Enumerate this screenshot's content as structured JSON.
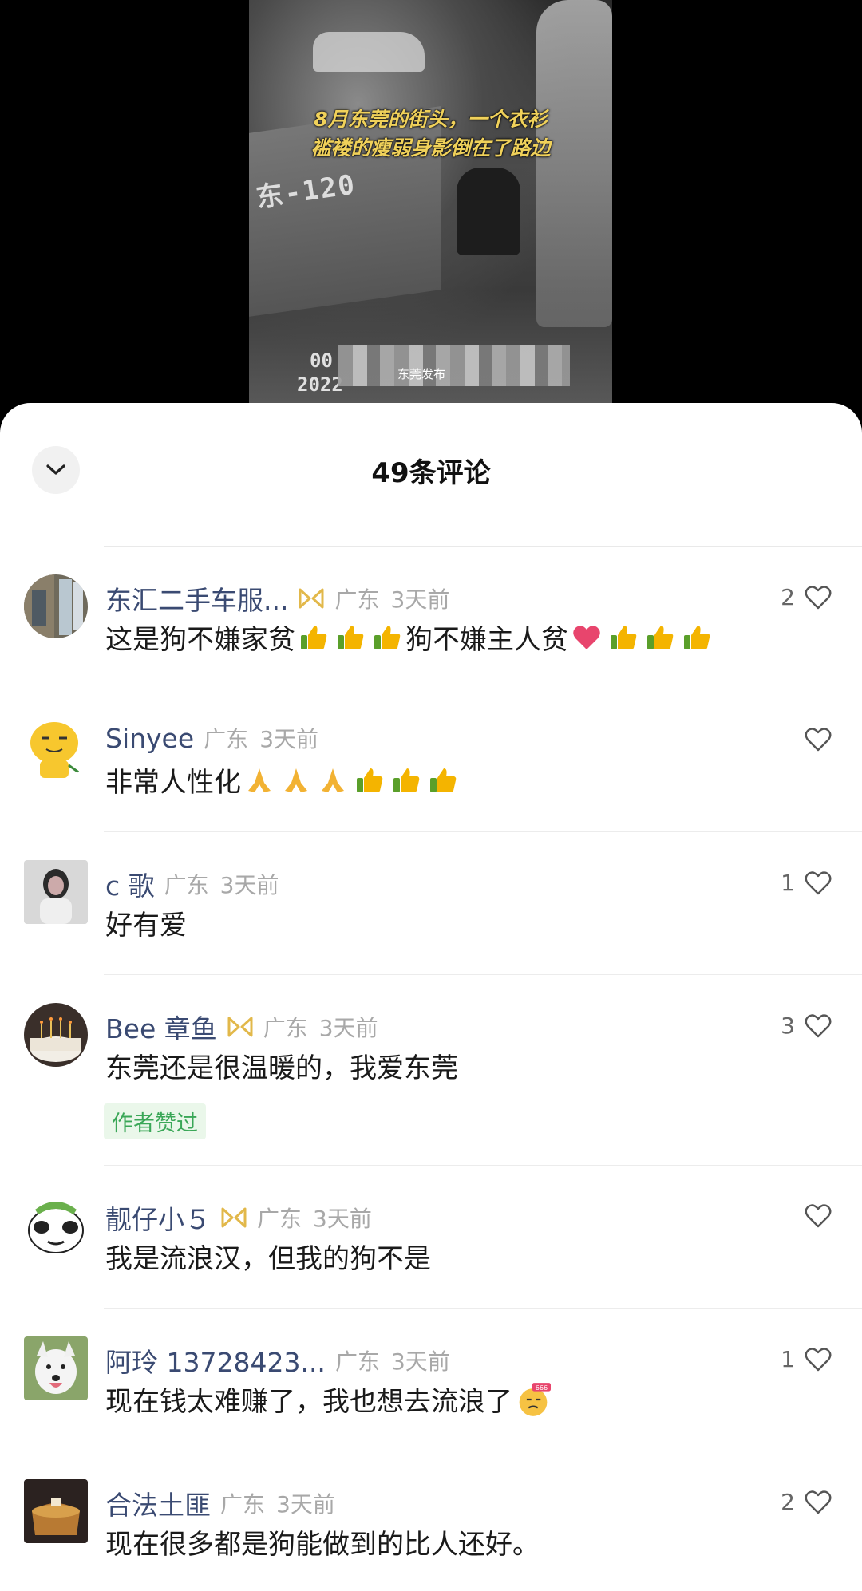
{
  "video": {
    "caption_line1": "8月东莞的街头，一个衣衫",
    "caption_line2": "褴褛的瘦弱身影倒在了路边",
    "bus_text": "东-120",
    "stamp_1": "00",
    "stamp_2": "2022",
    "watermark": "东莞发布"
  },
  "sheet": {
    "title": "49条评论",
    "close_icon": "chevron-down-icon"
  },
  "comments": [
    {
      "username": "东汇二手车服...",
      "has_badge": true,
      "location": "广东",
      "time": "3天前",
      "text_a": "这是狗不嫌家贫",
      "text_b": "狗不嫌主人贫",
      "likes": "2"
    },
    {
      "username": "Sinyee",
      "has_badge": false,
      "location": "广东",
      "time": "3天前",
      "text_a": "非常人性化",
      "likes": ""
    },
    {
      "username": "c 歌",
      "has_badge": false,
      "location": "广东",
      "time": "3天前",
      "text_a": "好有爱",
      "likes": "1"
    },
    {
      "username": "Bee 章鱼",
      "has_badge": true,
      "location": "广东",
      "time": "3天前",
      "text_a": "东莞还是很温暖的，我爱东莞",
      "likes": "3",
      "tag": "作者赞过"
    },
    {
      "username": "靓仔小５",
      "has_badge": true,
      "location": "广东",
      "time": "3天前",
      "text_a": "我是流浪汉，但我的狗不是",
      "likes": ""
    },
    {
      "username": "阿玲 13728423...",
      "has_badge": false,
      "location": "广东",
      "time": "3天前",
      "text_a": "现在钱太难赚了，我也想去流浪了",
      "likes": "1"
    },
    {
      "username": "合法土匪",
      "has_badge": false,
      "location": "广东",
      "time": "3天前",
      "text_a": "现在很多都是狗能做到的比人还好。",
      "likes": "2"
    }
  ],
  "colors": {
    "username": "#3a4a72",
    "meta": "#a8a8a8",
    "author_liked_bg": "#eaf7ea",
    "author_liked_text": "#3aa757"
  }
}
